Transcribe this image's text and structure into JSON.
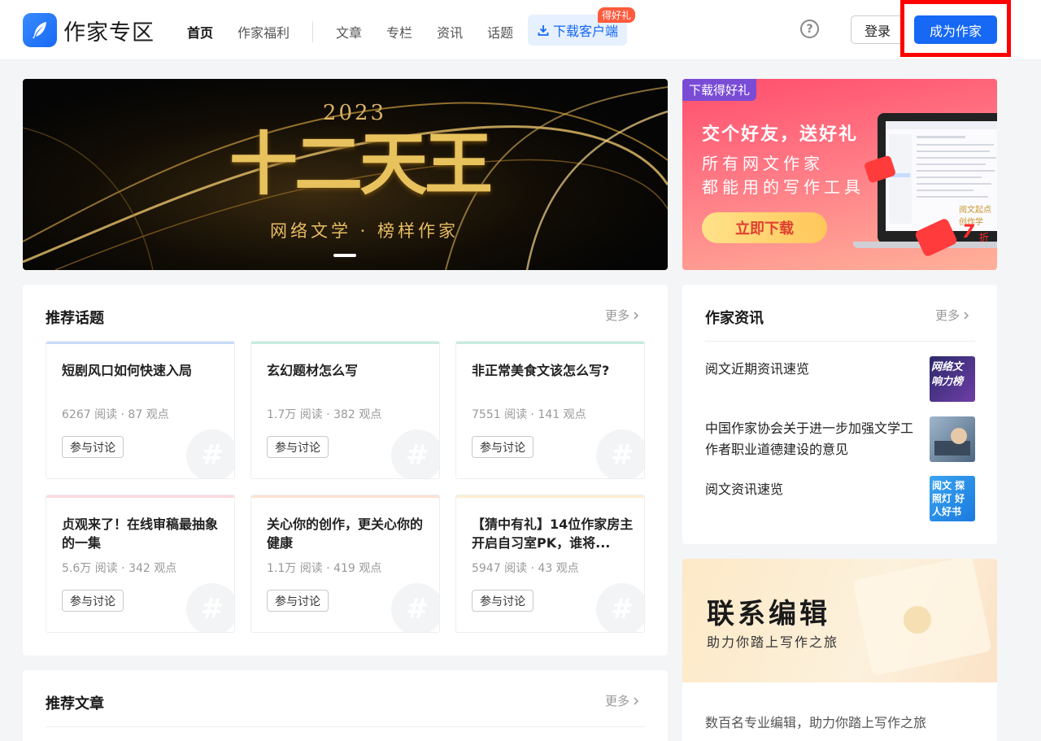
{
  "header": {
    "logo_text": "作家专区",
    "nav": [
      {
        "label": "首页",
        "active": true
      },
      {
        "label": "作家福利",
        "active": false
      },
      {
        "label": "文章",
        "active": false
      },
      {
        "label": "专栏",
        "active": false
      },
      {
        "label": "资讯",
        "active": false
      },
      {
        "label": "话题",
        "active": false
      }
    ],
    "download_label": "下载客户端",
    "download_badge": "得好礼",
    "help_glyph": "?",
    "login_label": "登录",
    "become_author_label": "成为作家"
  },
  "banner_main": {
    "year": "2023",
    "title": "十二天王",
    "subtitle": "网络文学 · 榜样作家"
  },
  "banner_side": {
    "tag": "下载得好礼",
    "headline": "交个好友，送好礼",
    "line1": "所有网文作家",
    "line2": "都能用的写作工具",
    "cta": "立即下载",
    "product": "阅文起点创作学",
    "discount_num": "7",
    "discount_unit": "折"
  },
  "topics": {
    "title": "推荐话题",
    "more": "更多",
    "items": [
      {
        "title": "短剧风口如何快速入局",
        "stats": "6267 阅读 · 87 观点",
        "join": "参与讨论",
        "bar": "#c9dcf7"
      },
      {
        "title": "玄幻题材怎么写",
        "stats": "1.7万 阅读 · 382 观点",
        "join": "参与讨论",
        "bar": "#c7ecdf"
      },
      {
        "title": "非正常美食文该怎么写?",
        "stats": "7551 阅读 · 141 观点",
        "join": "参与讨论",
        "bar": "#c7ecdf"
      },
      {
        "title": "贞观来了！在线审稿最抽象的一集",
        "stats": "5.6万 阅读 · 342 观点",
        "join": "参与讨论",
        "bar": "#fadadd"
      },
      {
        "title": "关心你的创作，更关心你的健康",
        "stats": "1.1万 阅读 · 419 观点",
        "join": "参与讨论",
        "bar": "#fde2d2"
      },
      {
        "title": "【猜中有礼】14位作家房主开启自习室PK，谁将...",
        "stats": "5947 阅读 · 43 观点",
        "join": "参与讨论",
        "bar": "#fdeed2"
      }
    ]
  },
  "articles": {
    "title": "推荐文章",
    "more": "更多"
  },
  "news": {
    "title": "作家资讯",
    "more": "更多",
    "items": [
      {
        "title": "阅文近期资讯速览",
        "thumb_text": "网络文 响力榜"
      },
      {
        "title": "中国作家协会关于进一步加强文学工作者职业道德建设的意见",
        "thumb_text": ""
      },
      {
        "title": "阅文资讯速览",
        "thumb_text": "阅文 探照灯 好人好书"
      }
    ]
  },
  "editor": {
    "title": "联系编辑",
    "subtitle": "助力你踏上写作之旅",
    "desc": "数百名专业编辑，助力你踏上写作之旅"
  },
  "colors": {
    "brand": "#1668f5",
    "highlight": "#ff0000"
  }
}
